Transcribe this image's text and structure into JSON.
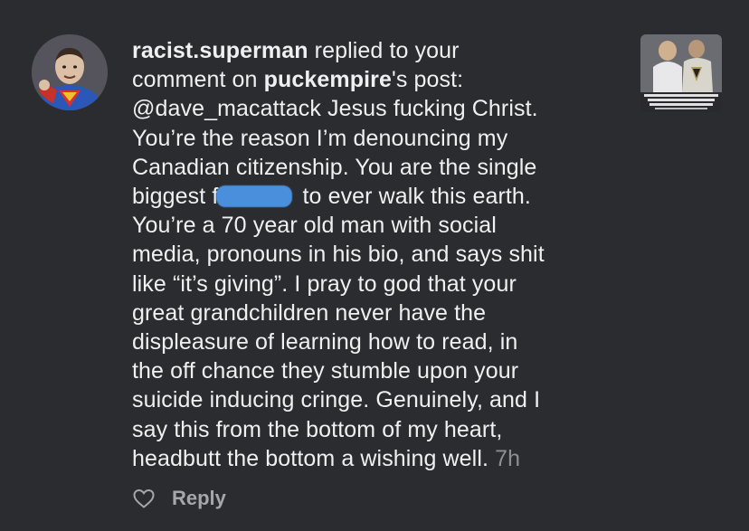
{
  "notification": {
    "username": "racist.superman",
    "action_text": " replied to your",
    "line2_prefix": "comment on ",
    "post_owner": "puckempire",
    "line2_suffix": "'s post:",
    "body_lines": [
      "@dave_macattack Jesus fucking Christ.",
      "You’re the reason I’m denouncing my",
      "Canadian citizenship. You are the single",
      "biggest f",
      " to ever walk this earth.",
      "You’re a 70 year old man with social",
      "media, pronouns in his bio, and says shit",
      "like “it’s giving”. I pray to god that your",
      "great grandchildren never have the",
      "displeasure of learning how to read, in",
      "the off chance they stumble upon your",
      "suicide inducing cringe. Genuinely, and I",
      "say this from the bottom of my heart,",
      "headbutt the bottom a wishing well. "
    ],
    "timestamp": "7h",
    "reply_label": "Reply",
    "thumb_caption": "BRETT HOWDEN CALLED \"DISAPPOINTED\" BY DAVID HOUSTON'S LAWYER AND TO BE HEARD A SUMMON BEFORE HIS TESTIMONY"
  },
  "colors": {
    "background": "#2b2c30",
    "text": "#f0f0f0",
    "muted": "#8e8e93",
    "redaction": "#4a8fdc"
  },
  "icons": {
    "like": "heart-outline-icon"
  }
}
